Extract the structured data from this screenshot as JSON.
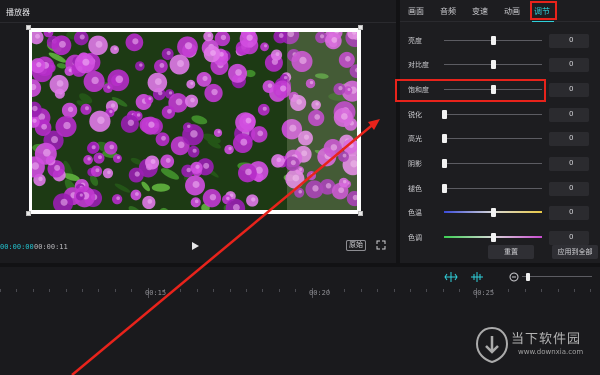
{
  "player": {
    "title": "播放器",
    "time_current": "00:00:00",
    "time_total": "00:00:11",
    "ratio_label": "原始",
    "play_icon": "play-icon",
    "fullscreen_icon": "fullscreen-icon"
  },
  "adjust": {
    "tabs": [
      {
        "label": "画面",
        "active": false
      },
      {
        "label": "音频",
        "active": false
      },
      {
        "label": "变速",
        "active": false
      },
      {
        "label": "动画",
        "active": false
      },
      {
        "label": "调节",
        "active": true
      }
    ],
    "rows": [
      {
        "label": "亮度",
        "value": "0",
        "level": 0.5
      },
      {
        "label": "对比度",
        "value": "0",
        "level": 0.5
      },
      {
        "label": "饱和度",
        "value": "0",
        "level": 0.5
      },
      {
        "label": "锐化",
        "value": "0",
        "level": 0
      },
      {
        "label": "高光",
        "value": "0",
        "level": 0
      },
      {
        "label": "阴影",
        "value": "0",
        "level": 0
      },
      {
        "label": "褪色",
        "value": "0",
        "level": 0
      },
      {
        "label": "色温",
        "value": "0",
        "level": 0.5
      },
      {
        "label": "色调",
        "value": "0",
        "level": 0.5
      }
    ],
    "reset_label": "重置",
    "apply_all_label": "应用到全部"
  },
  "timeline": {
    "ruler_labels": [
      "00:15",
      "00:20",
      "00:25"
    ],
    "zoom_level": 0.05
  },
  "watermark": {
    "cn": "当下软件园",
    "en": "www.downxia.com"
  },
  "colors": {
    "accent": "#2fd0da",
    "highlight": "#e8231b",
    "panel": "#1d1d20",
    "background": "#121214"
  }
}
